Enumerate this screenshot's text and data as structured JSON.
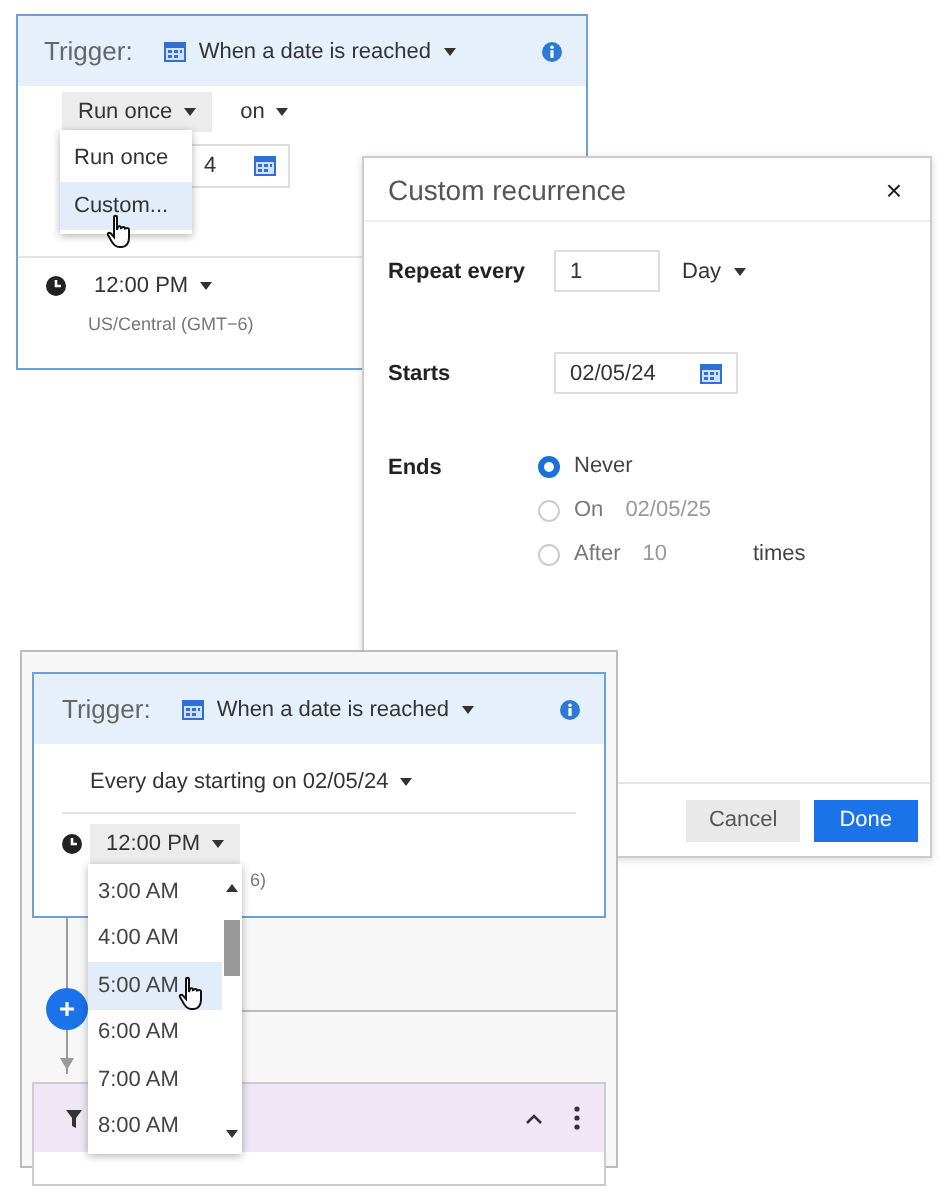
{
  "panel_top": {
    "trigger_label": "Trigger:",
    "trigger_type": "When a date is reached",
    "frequency": "Run once",
    "on_label": "on",
    "date_value": "4",
    "menu": [
      {
        "label": "Run once",
        "selected": false
      },
      {
        "label": "Custom...",
        "selected": true
      }
    ],
    "time": "12:00 PM",
    "timezone": "US/Central (GMT−6)"
  },
  "dialog": {
    "title": "Custom recurrence",
    "close": "×",
    "repeat_label": "Repeat every",
    "repeat_value": "1",
    "unit": "Day",
    "starts_label": "Starts",
    "start_date": "02/05/24",
    "ends_label": "Ends",
    "end_options": [
      {
        "label": "Never",
        "selected": true
      },
      {
        "label": "On",
        "value": "02/05/25",
        "selected": false
      },
      {
        "label": "After",
        "value": "10",
        "suffix": "times",
        "selected": false
      }
    ],
    "buttons": [
      {
        "label": "Cancel",
        "kind": "secondary"
      },
      {
        "label": "Done",
        "kind": "primary"
      }
    ]
  },
  "panel_bottom": {
    "trigger_label": "Trigger:",
    "trigger_type": "When a date is reached",
    "schedule": "Every day starting on 02/05/24",
    "time": "12:00 PM",
    "timezone": "6)",
    "time_options": [
      {
        "label": "3:00 AM",
        "selected": false
      },
      {
        "label": "4:00 AM",
        "selected": false
      },
      {
        "label": "5:00 AM",
        "selected": true
      },
      {
        "label": "6:00 AM",
        "selected": false
      },
      {
        "label": "7:00 AM",
        "selected": false
      },
      {
        "label": "8:00 AM",
        "selected": false
      }
    ]
  }
}
